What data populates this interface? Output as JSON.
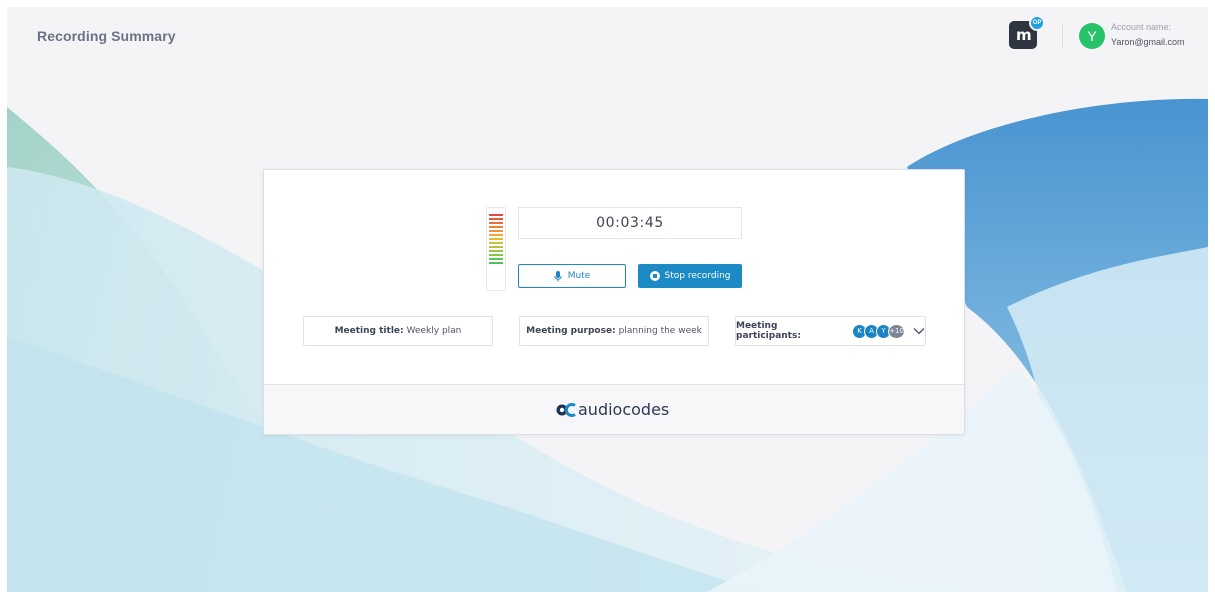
{
  "header": {
    "page_title": "Recording Summary",
    "app_logo_letter": "m",
    "app_logo_badge": "OP",
    "account_avatar_letter": "Y",
    "account_label": "Account name:",
    "account_email": "Yaron@gmail.com"
  },
  "recorder": {
    "timer": "00:03:45",
    "mute_label": "Mute",
    "stop_label": "Stop recording",
    "level_meter_colors": [
      "#e8483f",
      "#ec5a3d",
      "#ef6c3b",
      "#f1803a",
      "#f29438",
      "#f3a736",
      "#e7b835",
      "#cfc138",
      "#b3c63d",
      "#98c942",
      "#7dca49",
      "#5fc752",
      "#4ec35c"
    ]
  },
  "meeting": {
    "title_label": "Meeting title:",
    "title_value": "Weekly plan",
    "purpose_label": "Meeting purpose:",
    "purpose_value": "planning the week",
    "participants_label": "Meeting participants:",
    "participants": [
      {
        "initial": "K",
        "color": "#1c83c5"
      },
      {
        "initial": "A",
        "color": "#1c83c5"
      },
      {
        "initial": "Y",
        "color": "#1c83c5"
      }
    ],
    "more_count": "+10"
  },
  "footer": {
    "brand_text": "audiocodes"
  },
  "colors": {
    "accent": "#1b8ac5",
    "background": "#f4f4f7"
  }
}
